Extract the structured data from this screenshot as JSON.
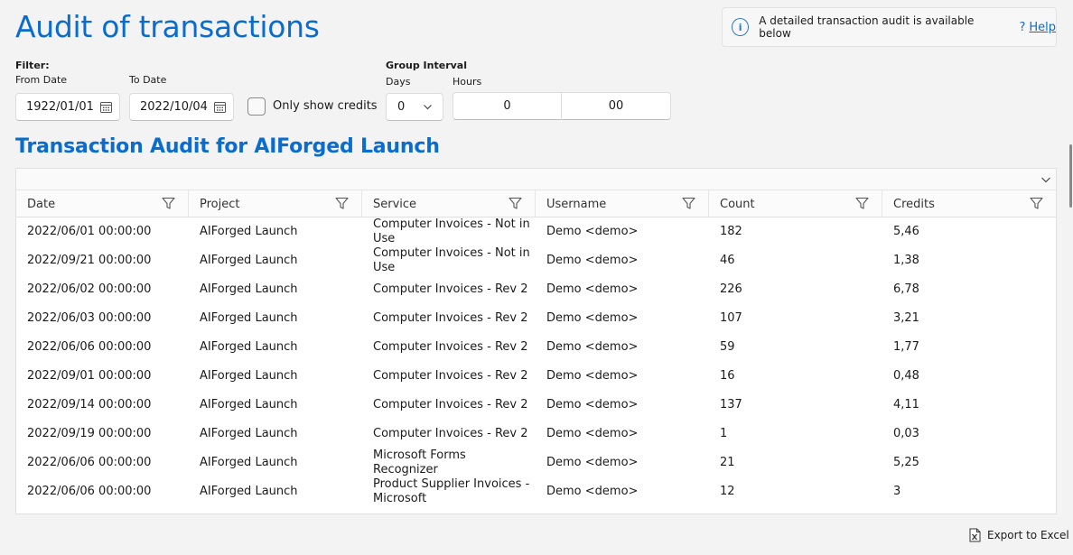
{
  "page": {
    "title": "Audit of transactions"
  },
  "info": {
    "message": "A detailed transaction audit is available below",
    "help_q": "?",
    "help_label": "Help"
  },
  "filter": {
    "label": "Filter:",
    "from_label": "From Date",
    "from_value": "1922/01/01",
    "to_label": "To Date",
    "to_value": "2022/10/04",
    "credits_only_label": "Only show credits",
    "credits_only_checked": false
  },
  "group_interval": {
    "label": "Group Interval",
    "days_label": "Days",
    "days_value": "0",
    "hours_label": "Hours",
    "hours_value": "0",
    "minutes_value": "00"
  },
  "section": {
    "title": "Transaction Audit for AIForged Launch"
  },
  "table": {
    "columns": [
      "Date",
      "Project",
      "Service",
      "Username",
      "Count",
      "Credits"
    ],
    "rows": [
      [
        "2022/06/01 00:00:00",
        "AIForged Launch",
        "Computer Invoices - Not in Use",
        "Demo <demo>",
        "182",
        "5,46"
      ],
      [
        "2022/09/21 00:00:00",
        "AIForged Launch",
        "Computer Invoices - Not in Use",
        "Demo <demo>",
        "46",
        "1,38"
      ],
      [
        "2022/06/02 00:00:00",
        "AIForged Launch",
        "Computer Invoices - Rev 2",
        "Demo <demo>",
        "226",
        "6,78"
      ],
      [
        "2022/06/03 00:00:00",
        "AIForged Launch",
        "Computer Invoices - Rev 2",
        "Demo <demo>",
        "107",
        "3,21"
      ],
      [
        "2022/06/06 00:00:00",
        "AIForged Launch",
        "Computer Invoices - Rev 2",
        "Demo <demo>",
        "59",
        "1,77"
      ],
      [
        "2022/09/01 00:00:00",
        "AIForged Launch",
        "Computer Invoices - Rev 2",
        "Demo <demo>",
        "16",
        "0,48"
      ],
      [
        "2022/09/14 00:00:00",
        "AIForged Launch",
        "Computer Invoices - Rev 2",
        "Demo <demo>",
        "137",
        "4,11"
      ],
      [
        "2022/09/19 00:00:00",
        "AIForged Launch",
        "Computer Invoices - Rev 2",
        "Demo <demo>",
        "1",
        "0,03"
      ],
      [
        "2022/06/06 00:00:00",
        "AIForged Launch",
        "Microsoft Forms Recognizer",
        "Demo <demo>",
        "21",
        "5,25"
      ],
      [
        "2022/06/06 00:00:00",
        "AIForged Launch",
        "Product Supplier Invoices - Microsoft",
        "Demo <demo>",
        "12",
        "3"
      ],
      [
        "",
        "",
        "Product Supplier Invoices -",
        "",
        "",
        ""
      ]
    ]
  },
  "actions": {
    "export_label": "Export to Excel"
  },
  "colors": {
    "accent": "#0a6ccf",
    "background": "#f3f3f3"
  }
}
